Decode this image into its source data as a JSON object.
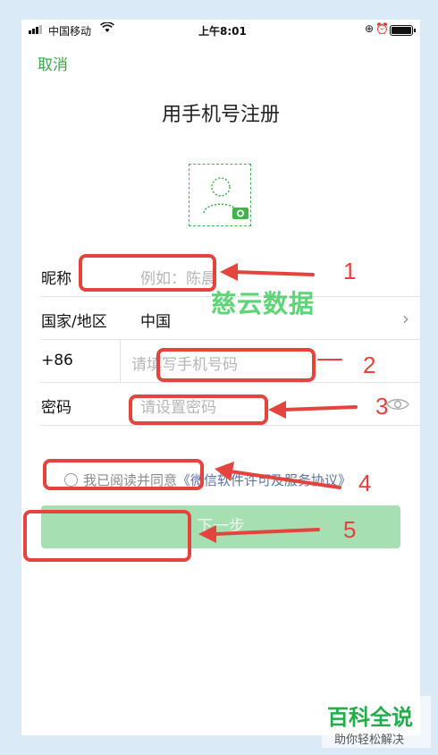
{
  "status_bar": {
    "carrier": "中国移动",
    "time": "上午8:01"
  },
  "nav": {
    "cancel_label": "取消"
  },
  "title": "用手机号注册",
  "form": {
    "nickname_label": "昵称",
    "nickname_placeholder": "例如：陈晨",
    "region_label": "国家/地区",
    "region_value": "中国",
    "country_code": "+86",
    "phone_placeholder": "请填写手机号码",
    "password_label": "密码",
    "password_placeholder": "请设置密码"
  },
  "agreement": {
    "prefix": "我已阅读并同意",
    "link": "《微信软件许可及服务协议》"
  },
  "next_button_label": "下一步",
  "watermark": "慈云数据",
  "annotations": [
    "1",
    "2",
    "3",
    "4",
    "5"
  ],
  "brand": {
    "name": "百科全说",
    "tagline": "助你轻松解决"
  },
  "colors": {
    "accent_green": "#3aa84a",
    "button_disabled": "#a6e0b2",
    "annotation_red": "#e5433d",
    "link_blue": "#5a73a8"
  }
}
